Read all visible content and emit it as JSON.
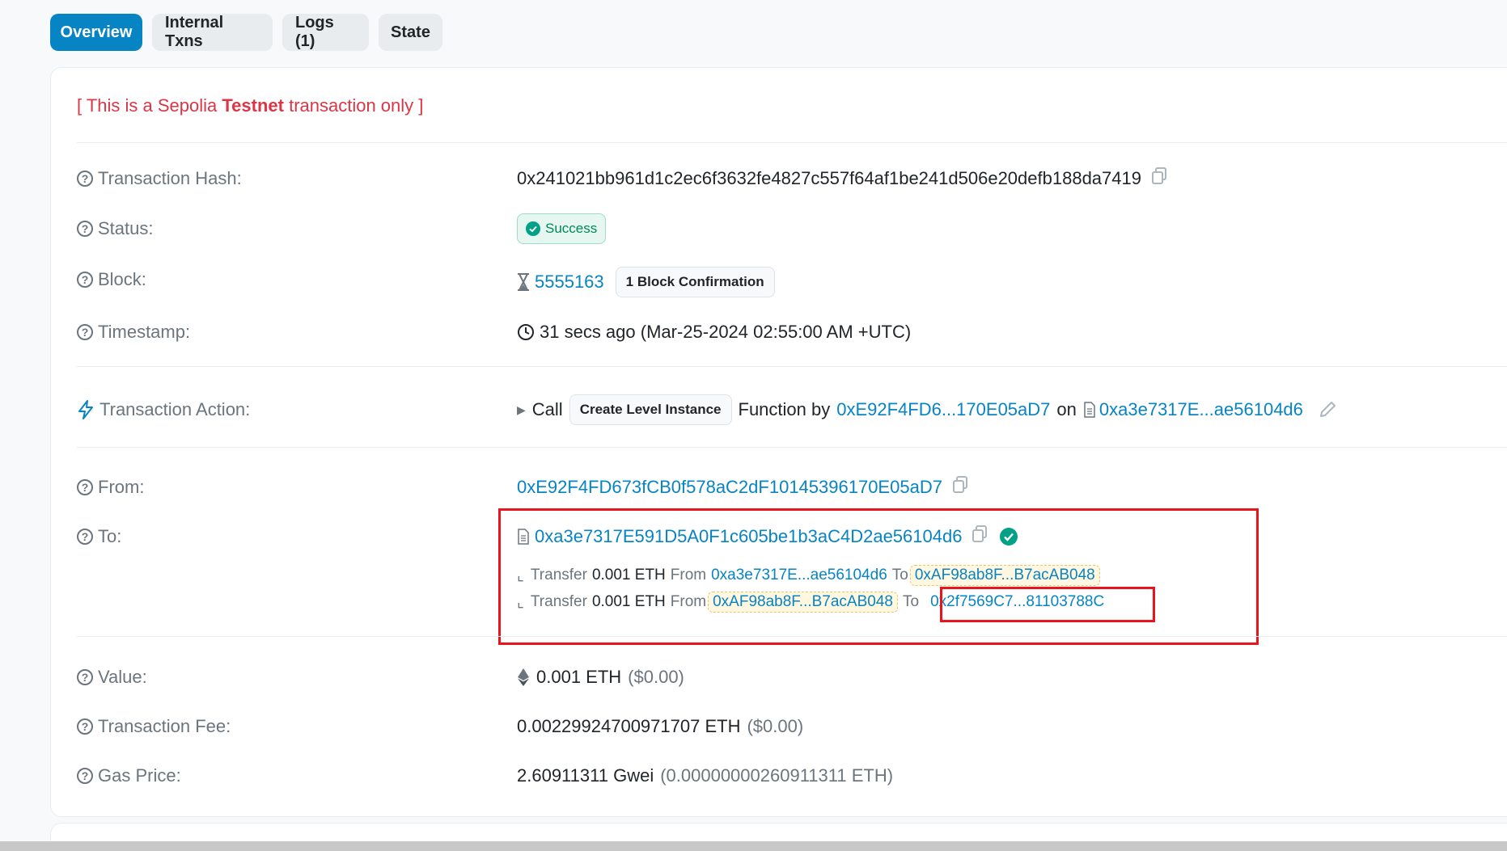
{
  "tabs": [
    "Overview",
    "Internal Txns",
    "Logs (1)",
    "State"
  ],
  "notice": {
    "prefix": "[ This is a Sepolia ",
    "bold": "Testnet",
    "suffix": " transaction only ]"
  },
  "labels": {
    "tx_hash": "Transaction Hash:",
    "status": "Status:",
    "block": "Block:",
    "timestamp": "Timestamp:",
    "action": "Transaction Action:",
    "from": "From:",
    "to": "To:",
    "value": "Value:",
    "fee": "Transaction Fee:",
    "gas": "Gas Price:"
  },
  "tx_hash": "0x241021bb961d1c2ec6f3632fe4827c557f64af1be241d506e20defb188da7419",
  "status": "Success",
  "block": {
    "number": "5555163",
    "confirmations": "1 Block Confirmation"
  },
  "timestamp": "31 secs ago (Mar-25-2024 02:55:00 AM +UTC)",
  "action": {
    "call": "Call",
    "function": "Create Level Instance",
    "by_text": "Function by",
    "by_addr": "0xE92F4FD6...170E05aD7",
    "on_text": "on",
    "on_addr": "0xa3e7317E...ae56104d6"
  },
  "from": "0xE92F4FD673fCB0f578aC2dF10145396170E05aD7",
  "to": "0xa3e7317E591D5A0F1c605be1b3aC4D2ae56104d6",
  "transfers": [
    {
      "word": "Transfer",
      "amount": "0.001 ETH",
      "from_word": "From",
      "from": "0xa3e7317E...ae56104d6",
      "to_word": "To",
      "to": "0xAF98ab8F...B7acAB048"
    },
    {
      "word": "Transfer",
      "amount": "0.001 ETH",
      "from_word": "From",
      "from": "0xAF98ab8F...B7acAB048",
      "to_word": "To",
      "to": "0x2f7569C7...81103788C"
    }
  ],
  "value": {
    "eth": "0.001 ETH",
    "usd": "($0.00)"
  },
  "fee": {
    "eth": "0.00229924700971707 ETH",
    "usd": "($0.00)"
  },
  "gas": {
    "gwei": "2.60911311 Gwei",
    "eth": "(0.00000000260911311 ETH)"
  },
  "colors": {
    "accent": "#0784c3",
    "danger": "#dc3545",
    "success": "#00a186",
    "highlight": "#e8141e"
  }
}
